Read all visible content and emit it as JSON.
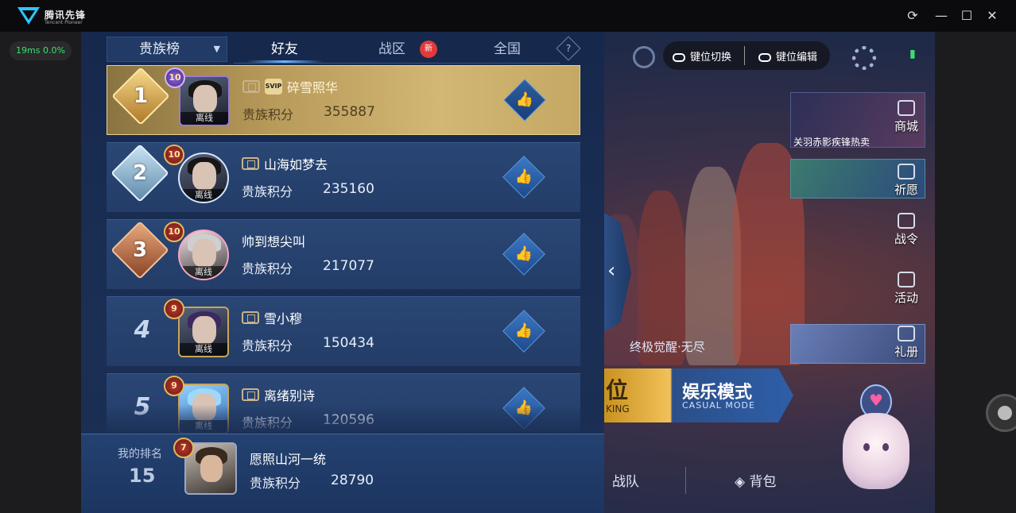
{
  "window": {
    "app_name": "腾讯先锋",
    "app_subtitle": "Tencent Pioneer",
    "ping": "19ms  0.0%"
  },
  "tabs": {
    "dropdown": "贵族榜",
    "items": [
      {
        "label": "好友",
        "active": true
      },
      {
        "label": "战区",
        "active": false
      },
      {
        "label": "全国",
        "active": false
      }
    ],
    "new_badge": "新",
    "help": "?"
  },
  "leaderboard": {
    "score_label": "贵族积分",
    "offline_label": "离线",
    "rows": [
      {
        "rank": "1",
        "level": "10",
        "name": "碎雪照华",
        "score": "355887",
        "svip": "SVIP"
      },
      {
        "rank": "2",
        "level": "10",
        "name": "山海如梦去",
        "score": "235160"
      },
      {
        "rank": "3",
        "level": "10",
        "name": "帅到想尖叫",
        "score": "217077"
      },
      {
        "rank": "4",
        "level": "9",
        "name": "雪小穆",
        "score": "150434"
      },
      {
        "rank": "5",
        "level": "9",
        "name": "离绪别诗",
        "score": "120596"
      }
    ]
  },
  "my_rank": {
    "label": "我的排名",
    "rank": "15",
    "level": "7",
    "name": "愿照山河一统",
    "score_label": "贵族积分",
    "score": "28790"
  },
  "game_ui": {
    "key_switch": "键位切换",
    "key_edit": "键位编辑",
    "promo_text": "关羽赤影疾锋热卖",
    "menu": {
      "shop": "商城",
      "wish": "祈愿",
      "battlepass": "战令",
      "event": "活动",
      "gift": "礼册"
    },
    "ultimate": "终极觉醒·无尽",
    "mode_main": "娱乐模式",
    "mode_sub": "CASUAL MODE",
    "mode_left": "位",
    "mode_left_sub": "KING",
    "team": "战队",
    "bag": "背包"
  }
}
